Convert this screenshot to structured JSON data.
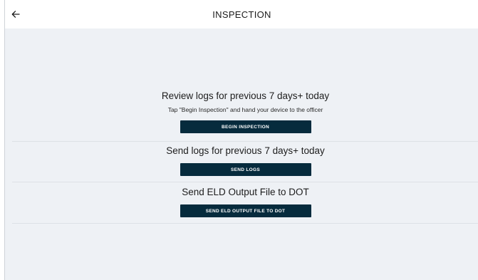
{
  "header": {
    "title": "INSPECTION",
    "back_icon": "arrow-left-icon"
  },
  "sections": [
    {
      "heading": "Review logs for previous 7 days+ today",
      "subtext": "Tap \"Begin Inspection\" and hand your device to the officer",
      "button_label": "BEGIN INSPECTION"
    },
    {
      "heading": "Send logs for previous 7 days+ today",
      "button_label": "SEND LOGS"
    },
    {
      "heading": "Send ELD Output File to DOT",
      "button_label": "SEND ELD OUTPUT FILE TO DOT"
    }
  ],
  "colors": {
    "background": "#eef1f5",
    "header_bg": "#ffffff",
    "button_bg": "#062b3d",
    "button_text": "#ffffff",
    "divider": "#dde1e6"
  }
}
